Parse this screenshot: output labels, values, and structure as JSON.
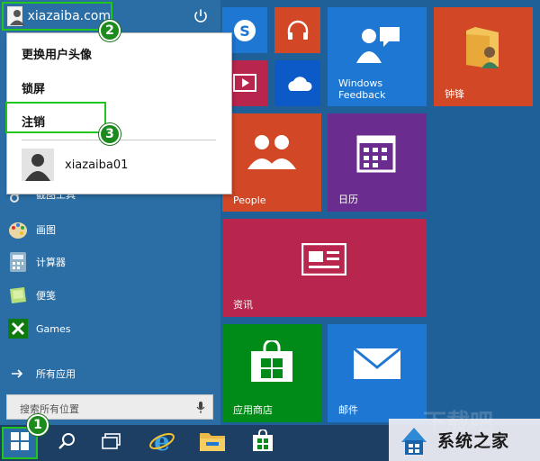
{
  "user": {
    "name": "xiazaiba.com"
  },
  "user_menu": {
    "change_avatar": "更换用户头像",
    "lock": "锁屏",
    "sign_out": "注销",
    "other_user": "xiazaiba01"
  },
  "callouts": [
    "1",
    "2",
    "3"
  ],
  "left_list": [
    {
      "label": "截图工具",
      "icon": "snipping-tool-icon"
    },
    {
      "label": "画图",
      "icon": "paint-icon"
    },
    {
      "label": "计算器",
      "icon": "calculator-icon"
    },
    {
      "label": "便笺",
      "icon": "sticky-notes-icon"
    },
    {
      "label": "Games",
      "icon": "games-icon"
    }
  ],
  "all_apps": "所有应用",
  "search": {
    "placeholder": "搜索所有位置"
  },
  "tiles": {
    "windows_feedback": "Windows Feedback",
    "zhongfeng": "钟锋",
    "people": "People",
    "calendar": "日历",
    "news": "资讯",
    "store": "应用商店",
    "mail": "邮件"
  },
  "colors": {
    "accent_green": "#22c41e",
    "desktop_blue": "#1f6099",
    "tile_blue": "#1e77d3",
    "tile_red": "#d24726",
    "tile_purple": "#6b2c8f",
    "tile_crimson": "#b8254d",
    "tile_green": "#008a17"
  },
  "watermark": {
    "text": "系统之家",
    "faded": "下载吧"
  }
}
